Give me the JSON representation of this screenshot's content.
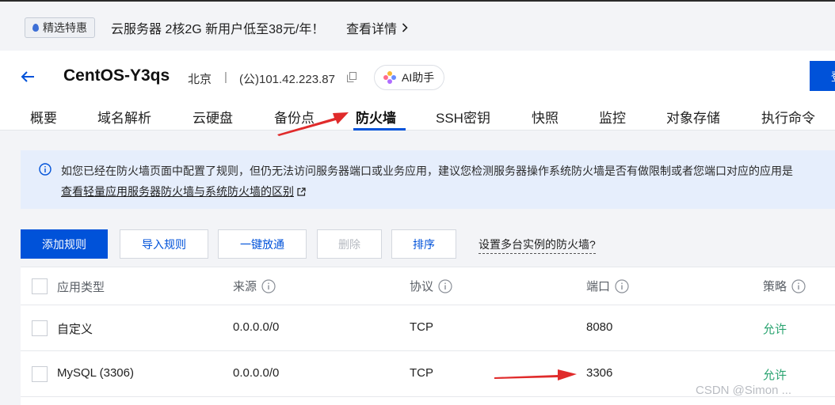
{
  "promo": {
    "badge": "精选特惠",
    "text": "云服务器 2核2G 新用户低至38元/年！",
    "link": "查看详情"
  },
  "header": {
    "instance_name": "CentOS-Y3qs",
    "region": "北京",
    "separator": "|",
    "ip": "(公)101.42.223.87",
    "ai_button": "AI助手",
    "right_button": "登"
  },
  "tabs": [
    {
      "label": "概要"
    },
    {
      "label": "域名解析"
    },
    {
      "label": "云硬盘"
    },
    {
      "label": "备份点"
    },
    {
      "label": "防火墙",
      "active": true
    },
    {
      "label": "SSH密钥"
    },
    {
      "label": "快照"
    },
    {
      "label": "监控"
    },
    {
      "label": "对象存储"
    },
    {
      "label": "执行命令"
    }
  ],
  "notice": {
    "text": "如您已经在防火墙页面中配置了规则，但仍无法访问服务器端口或业务应用，建议您检测服务器操作系统防火墙是否有做限制或者您端口对应的应用是",
    "link": "查看轻量应用服务器防火墙与系统防火墙的区别"
  },
  "actions": {
    "add": "添加规则",
    "import": "导入规则",
    "open_all": "一键放通",
    "delete": "删除",
    "sort": "排序",
    "help": "设置多台实例的防火墙?"
  },
  "table": {
    "columns": [
      "应用类型",
      "来源",
      "协议",
      "端口",
      "策略"
    ],
    "rows": [
      [
        "自定义",
        "0.0.0.0/0",
        "TCP",
        "8080",
        "允许"
      ],
      [
        "MySQL (3306)",
        "0.0.0.0/0",
        "TCP",
        "3306",
        "允许"
      ]
    ]
  },
  "watermark": "CSDN @Simon ...",
  "colors": {
    "primary": "#0052d9",
    "allow": "#2ba471",
    "annotation_arrow": "#e02b2b"
  }
}
